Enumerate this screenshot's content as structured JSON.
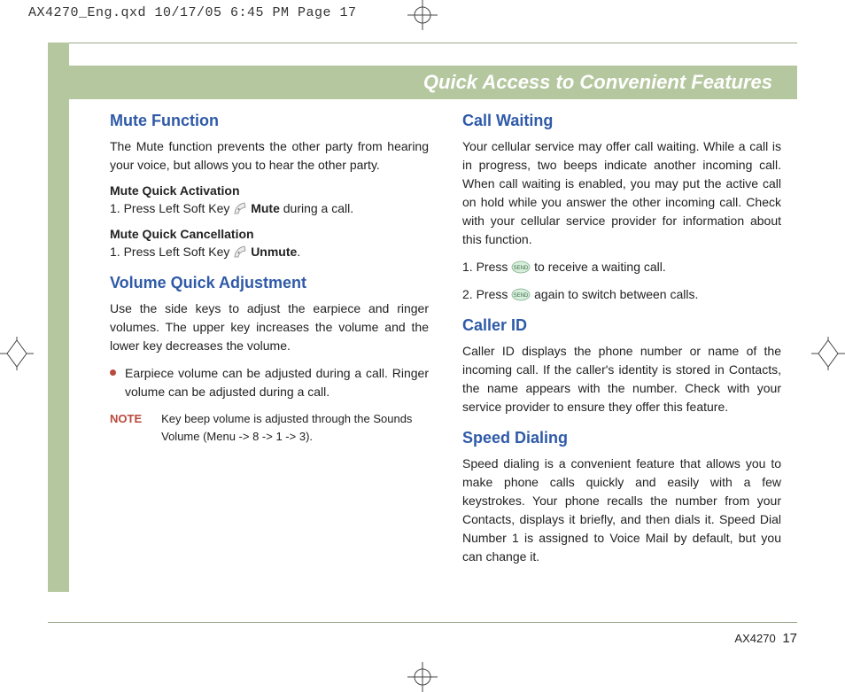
{
  "slug": "AX4270_Eng.qxd  10/17/05  6:45 PM  Page 17",
  "banner_title": "Quick Access to Convenient Features",
  "left": {
    "mute": {
      "heading": "Mute Function",
      "intro": "The Mute function prevents the other party from hearing your voice, but allows you to hear the other party.",
      "activation_sub": "Mute Quick Activation",
      "activation_step_pre": "1.  Press Left Soft Key ",
      "activation_step_bold": "Mute",
      "activation_step_post": " during a call.",
      "cancel_sub": "Mute Quick Cancellation",
      "cancel_step_pre": "1.  Press Left Soft Key ",
      "cancel_step_bold": "Unmute",
      "cancel_step_post": "."
    },
    "volume": {
      "heading": "Volume Quick Adjustment",
      "intro": "Use the side keys to adjust the earpiece and ringer volumes. The upper key increases the volume and the lower key decreases the volume.",
      "bullet": "Earpiece volume can be adjusted during a call. Ringer volume can be adjusted during a call.",
      "note_label": "NOTE",
      "note_text": "Key beep volume is adjusted through the Sounds Volume (Menu -> 8 -> 1 -> 3)."
    }
  },
  "right": {
    "call_waiting": {
      "heading": "Call Waiting",
      "intro": "Your cellular service may offer call waiting. While a call is in progress, two beeps indicate another incoming call. When call waiting is enabled, you may put the active call on hold while you answer the other incoming call. Check with your cellular service provider for information about this function.",
      "step1_pre": "1.  Press ",
      "step1_post": " to receive a waiting call.",
      "step2_pre": "2.  Press ",
      "step2_post": " again to switch between calls."
    },
    "caller_id": {
      "heading": "Caller ID",
      "body": "Caller ID displays the phone number or name of the incoming call. If the caller's identity is stored in Contacts, the name appears with the number. Check with your service provider to ensure they offer this feature."
    },
    "speed_dialing": {
      "heading": "Speed Dialing",
      "body": "Speed dialing is a convenient feature that allows you to make phone calls quickly and easily with a few keystrokes. Your phone recalls the number from your Contacts, displays it briefly, and then dials it. Speed Dial Number 1 is assigned to Voice Mail by default, but you can change it."
    }
  },
  "footer": {
    "model": "AX4270",
    "page": "17"
  }
}
